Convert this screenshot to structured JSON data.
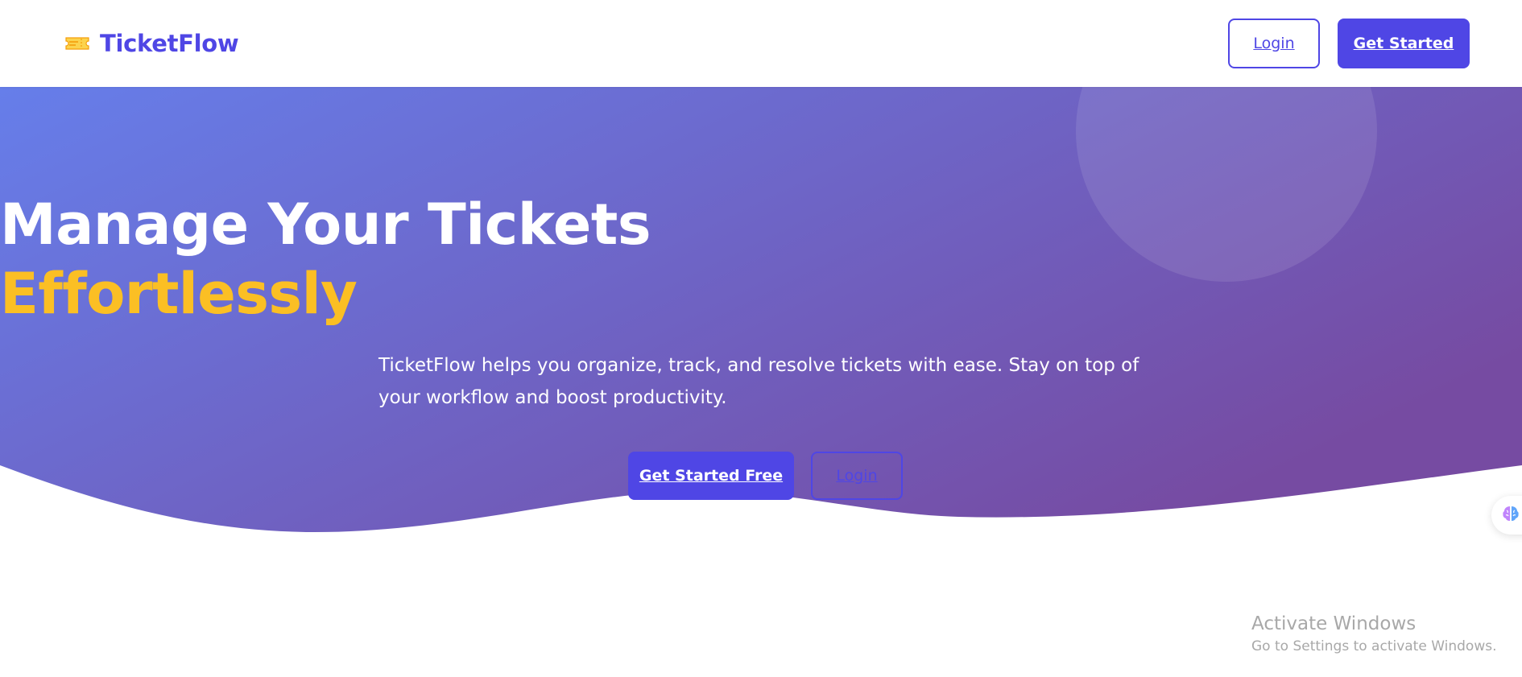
{
  "navbar": {
    "brand_name": "TicketFlow",
    "brand_icon": "ticket-icon",
    "login_label": "Login",
    "get_started_label": "Get Started"
  },
  "hero": {
    "title_line1": "Manage Your Tickets",
    "title_line2": "Effortlessly",
    "subtitle": "TicketFlow helps you organize, track, and resolve tickets with ease. Stay on top of your workflow and boost productivity.",
    "cta_primary_label": "Get Started Free",
    "cta_secondary_label": "Login"
  },
  "side_widget": {
    "icon": "brain-icon"
  },
  "os_watermark": {
    "title": "Activate Windows",
    "subtitle": "Go to Settings to activate Windows."
  },
  "colors": {
    "primary": "#4f46e5",
    "hero_gradient_start": "#667eea",
    "hero_gradient_end": "#764ba2",
    "accent": "#fbbf24"
  }
}
